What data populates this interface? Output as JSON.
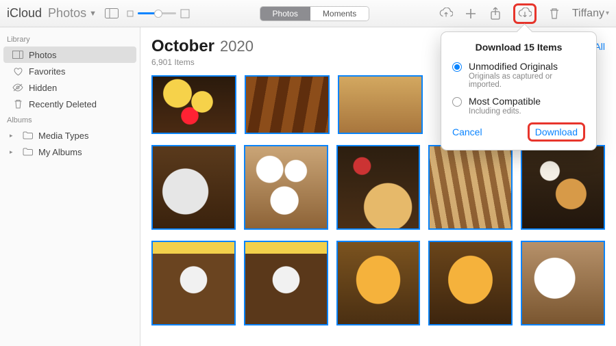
{
  "brand": {
    "primary": "iCloud",
    "secondary": "Photos"
  },
  "segments": {
    "photos": "Photos",
    "moments": "Moments"
  },
  "user": {
    "name": "Tiffany"
  },
  "sidebar": {
    "library_head": "Library",
    "albums_head": "Albums",
    "library": [
      {
        "label": "Photos"
      },
      {
        "label": "Favorites"
      },
      {
        "label": "Hidden"
      },
      {
        "label": "Recently Deleted"
      }
    ],
    "albums": [
      {
        "label": "Media Types"
      },
      {
        "label": "My Albums"
      }
    ]
  },
  "main": {
    "month": "October",
    "year": "2020",
    "count": "6,901 Items",
    "select_all": "ct All"
  },
  "popover": {
    "title": "Download 15 Items",
    "opt1": {
      "label": "Unmodified Originals",
      "sub": "Originals as captured or imported."
    },
    "opt2": {
      "label": "Most Compatible",
      "sub": "Including edits."
    },
    "cancel": "Cancel",
    "download": "Download"
  }
}
